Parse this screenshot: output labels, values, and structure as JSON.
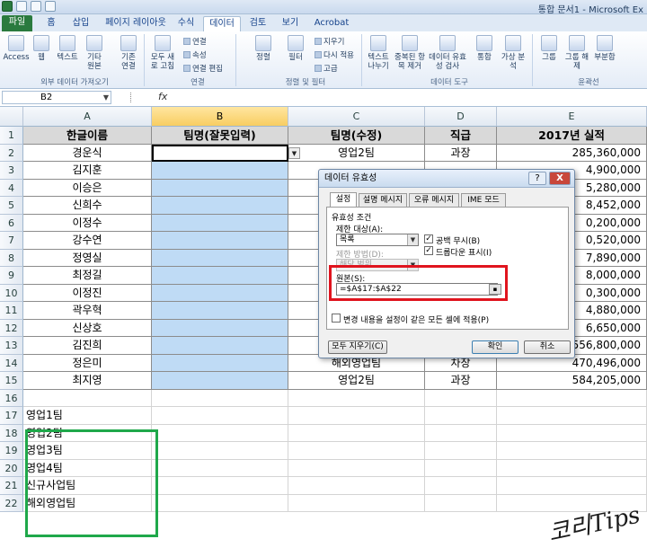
{
  "window": {
    "title": "통합 문서1 - Microsoft Ex"
  },
  "tabs": [
    "파일",
    "홈",
    "삽입",
    "페이지 레이아웃",
    "수식",
    "데이터",
    "검토",
    "보기",
    "Acrobat"
  ],
  "ribbon": {
    "buttons": [
      "Access",
      "웹",
      "텍스트",
      "기타 원본",
      "기존 연결",
      "모두 새로 고침",
      "정렬",
      "필터",
      "텍스트 나누기",
      "중복된 항목 제거",
      "데이터 유효성 검사",
      "통합",
      "가상 분석",
      "그룹",
      "그룹 해제",
      "부분합"
    ],
    "small": [
      "연결",
      "속성",
      "연결 편집",
      "지우기",
      "다시 적용",
      "고급"
    ],
    "groups": [
      "외부 데이터 가져오기",
      "연결",
      "정렬 및 필터",
      "데이터 도구",
      "윤곽선"
    ]
  },
  "formula_bar": {
    "name_box": "B2",
    "fx": "fx",
    "formula": ""
  },
  "columns": [
    "A",
    "B",
    "C",
    "D",
    "E"
  ],
  "header_row": {
    "row": "1",
    "A": "한글이름",
    "B": "팀명(잘못입력)",
    "C": "팀명(수정)",
    "D": "직급",
    "E": "2017년 실적"
  },
  "rows": [
    {
      "row": "2",
      "A": "경운식",
      "C": "영업2팀",
      "D": "과장",
      "E": "285,360,000"
    },
    {
      "row": "3",
      "A": "김지훈",
      "C": "",
      "D": "",
      "E": "4,900,000"
    },
    {
      "row": "4",
      "A": "이승은",
      "C": "",
      "D": "",
      "E": "5,280,000"
    },
    {
      "row": "5",
      "A": "신희수",
      "C": "",
      "D": "",
      "E": "8,452,000"
    },
    {
      "row": "6",
      "A": "이정수",
      "C": "",
      "D": "",
      "E": "0,200,000"
    },
    {
      "row": "7",
      "A": "강수연",
      "C": "",
      "D": "",
      "E": "0,520,000"
    },
    {
      "row": "8",
      "A": "정영실",
      "C": "",
      "D": "",
      "E": "7,890,000"
    },
    {
      "row": "9",
      "A": "최정길",
      "C": "",
      "D": "",
      "E": "8,000,000"
    },
    {
      "row": "10",
      "A": "이정진",
      "C": "",
      "D": "",
      "E": "0,300,000"
    },
    {
      "row": "11",
      "A": "곽우혁",
      "C": "",
      "D": "",
      "E": "4,880,000"
    },
    {
      "row": "12",
      "A": "신상호",
      "C": "",
      "D": "",
      "E": "6,650,000"
    },
    {
      "row": "13",
      "A": "김진희",
      "C": "영업4팀",
      "D": "대리",
      "E": "556,800,000"
    },
    {
      "row": "14",
      "A": "정은미",
      "C": "해외영업팀",
      "D": "차장",
      "E": "470,496,000"
    },
    {
      "row": "15",
      "A": "최지영",
      "C": "영업2팀",
      "D": "과장",
      "E": "584,205,000"
    }
  ],
  "empty_row": "16",
  "list_rows": [
    {
      "row": "17",
      "A": "영업1팀"
    },
    {
      "row": "18",
      "A": "영업2팀"
    },
    {
      "row": "19",
      "A": "영업3팀"
    },
    {
      "row": "20",
      "A": "영업4팀"
    },
    {
      "row": "21",
      "A": "신규사업팀"
    },
    {
      "row": "22",
      "A": "해외영업팀"
    }
  ],
  "dialog": {
    "title": "데이터 유효성",
    "help": "?",
    "close": "X",
    "tabs": [
      "설정",
      "설명 메시지",
      "오류 메시지",
      "IME 모드"
    ],
    "criteria_label": "유효성 조건",
    "allow_label": "제한 대상(A):",
    "allow_value": "목록",
    "ignore_blank": "공백 무시(B)",
    "dropdown": "드롭다운 표시(I)",
    "data_label": "제한 방법(D):",
    "data_value": "해당 범위",
    "source_label": "원본(S):",
    "source_value": "=$A$17:$A$22",
    "apply_all": "변경 내용을 설정이 같은 모든 셀에 적용(P)",
    "clear_all": "모두 지우기(C)",
    "ok": "확인",
    "cancel": "취소"
  },
  "watermark": "코리Tips",
  "colors": {
    "selected_fill": "#bfdbf5",
    "header_fill": "#d9d9d9",
    "red_highlight": "#e0141e",
    "green_highlight": "#1fa84a",
    "file_tab": "#2a7a3e"
  }
}
